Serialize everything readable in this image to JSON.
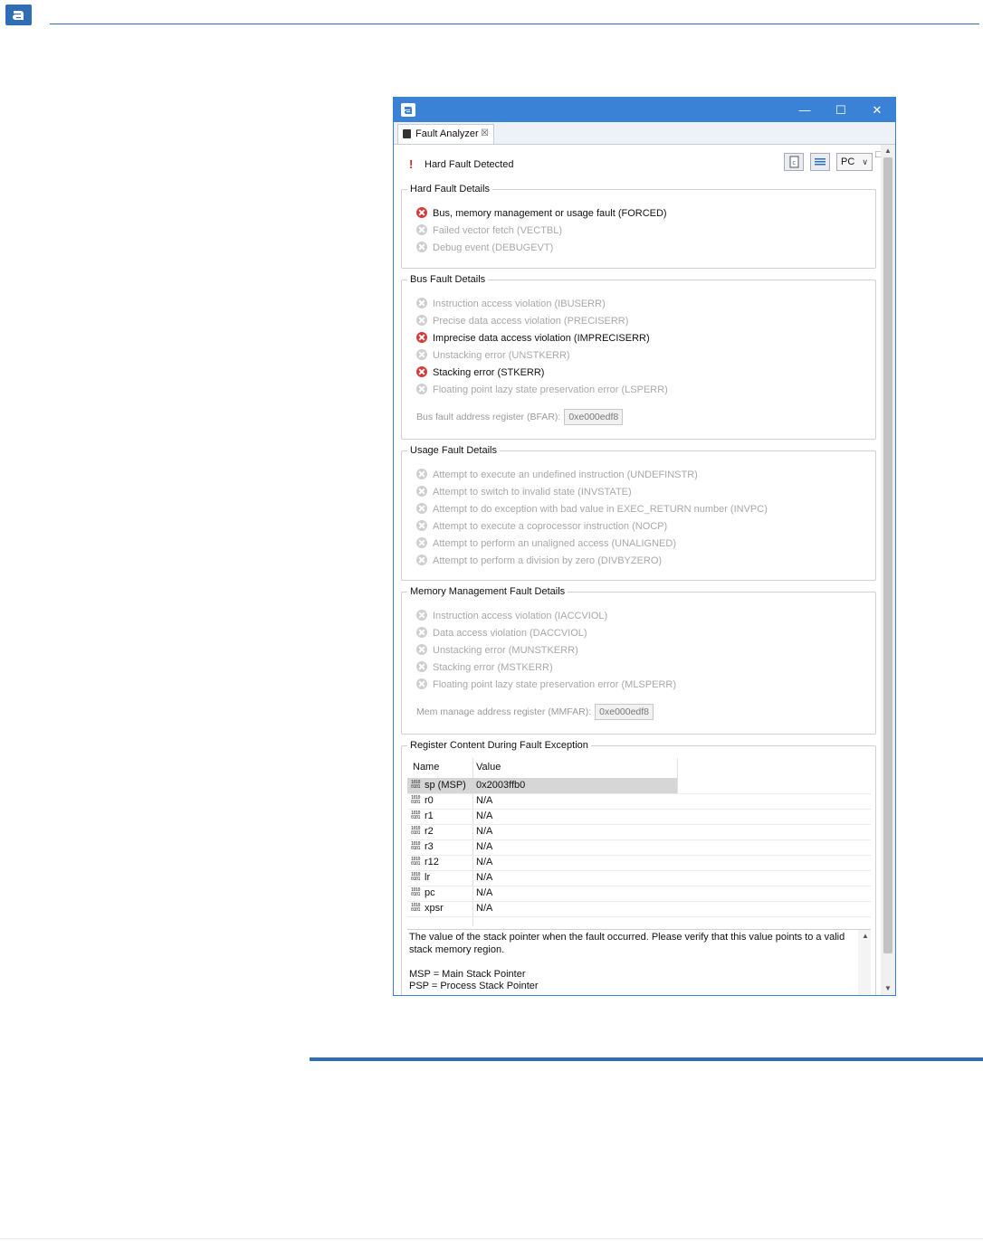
{
  "window": {
    "minimize": "—",
    "maximize": "☐",
    "close": "✕"
  },
  "tab": {
    "label": "Fault Analyzer",
    "close": "☒"
  },
  "view_controls": {
    "minimize": "—",
    "maximize": "□"
  },
  "header": {
    "status": "Hard Fault Detected",
    "register_select": "PC"
  },
  "hard_fault": {
    "title": "Hard Fault Details",
    "items": [
      {
        "label": "Bus, memory management or usage fault (FORCED)",
        "active": true
      },
      {
        "label": "Failed vector fetch (VECTBL)",
        "active": false
      },
      {
        "label": "Debug event (DEBUGEVT)",
        "active": false
      }
    ]
  },
  "bus_fault": {
    "title": "Bus Fault Details",
    "items": [
      {
        "label": "Instruction access violation (IBUSERR)",
        "active": false
      },
      {
        "label": "Precise data access violation (PRECISERR)",
        "active": false
      },
      {
        "label": "Imprecise data access violation (IMPRECISERR)",
        "active": true
      },
      {
        "label": "Unstacking error (UNSTKERR)",
        "active": false
      },
      {
        "label": "Stacking error (STKERR)",
        "active": true
      },
      {
        "label": "Floating point lazy state preservation error (LSPERR)",
        "active": false
      }
    ],
    "address_label": "Bus fault address register (BFAR):",
    "address_value": "0xe000edf8"
  },
  "usage_fault": {
    "title": "Usage Fault Details",
    "items": [
      {
        "label": "Attempt to execute an undefined instruction (UNDEFINSTR)",
        "active": false
      },
      {
        "label": "Attempt to switch to invalid state (INVSTATE)",
        "active": false
      },
      {
        "label": "Attempt to do exception with bad value in EXEC_RETURN number (INVPC)",
        "active": false
      },
      {
        "label": "Attempt to execute a coprocessor instruction (NOCP)",
        "active": false
      },
      {
        "label": "Attempt to perform an unaligned access (UNALIGNED)",
        "active": false
      },
      {
        "label": "Attempt to perform a division by zero (DIVBYZERO)",
        "active": false
      }
    ]
  },
  "mem_fault": {
    "title": "Memory Management Fault Details",
    "items": [
      {
        "label": "Instruction access violation (IACCVIOL)",
        "active": false
      },
      {
        "label": "Data access violation (DACCVIOL)",
        "active": false
      },
      {
        "label": "Unstacking error (MUNSTKERR)",
        "active": false
      },
      {
        "label": "Stacking error (MSTKERR)",
        "active": false
      },
      {
        "label": "Floating point lazy state preservation error (MLSPERR)",
        "active": false
      }
    ],
    "address_label": "Mem manage address register (MMFAR):",
    "address_value": "0xe000edf8"
  },
  "registers": {
    "title": "Register Content During Fault Exception",
    "col_name": "Name",
    "col_value": "Value",
    "icon_text": "1010\n0101",
    "rows": [
      {
        "name": "sp (MSP)",
        "value": "0x2003ffb0"
      },
      {
        "name": "r0",
        "value": "N/A"
      },
      {
        "name": "r1",
        "value": "N/A"
      },
      {
        "name": "r2",
        "value": "N/A"
      },
      {
        "name": "r3",
        "value": "N/A"
      },
      {
        "name": "r12",
        "value": "N/A"
      },
      {
        "name": "lr",
        "value": "N/A"
      },
      {
        "name": "pc",
        "value": "N/A"
      },
      {
        "name": "xpsr",
        "value": "N/A"
      }
    ],
    "description": [
      "The value of the stack pointer when the fault occurred. Please verify that this value points to a valid",
      "stack memory region.",
      "",
      "MSP = Main Stack Pointer",
      "PSP = Process Stack Pointer"
    ]
  }
}
